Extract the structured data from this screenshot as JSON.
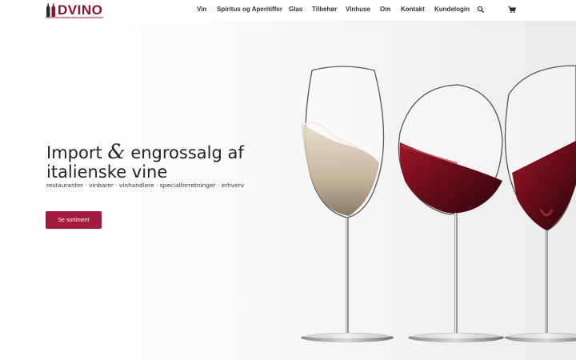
{
  "brand": {
    "logo_text": "DVINO",
    "accent_color": "#a31a3f",
    "logo_color": "#8a1532"
  },
  "nav": {
    "items": [
      {
        "label": "Vin"
      },
      {
        "label": "Spiritus og Aperitiffer"
      },
      {
        "label": "Glas"
      },
      {
        "label": "Tilbehør"
      },
      {
        "label": "Vinhuse"
      },
      {
        "label": "Om"
      },
      {
        "label": "Kontakt"
      },
      {
        "label": "Kundelogin"
      }
    ],
    "search_icon": "search-icon",
    "cart_icon": "cart-icon"
  },
  "hero": {
    "headline_part1": "Import ",
    "headline_amp": "&",
    "headline_part2": " engrossalg af",
    "headline_line2": "italienske vine",
    "subline": "restauranter · vinbarer · vinhandlere · specialforretninger · erhverv",
    "cta_label": "Se sortiment",
    "image": "three-wine-glasses"
  }
}
